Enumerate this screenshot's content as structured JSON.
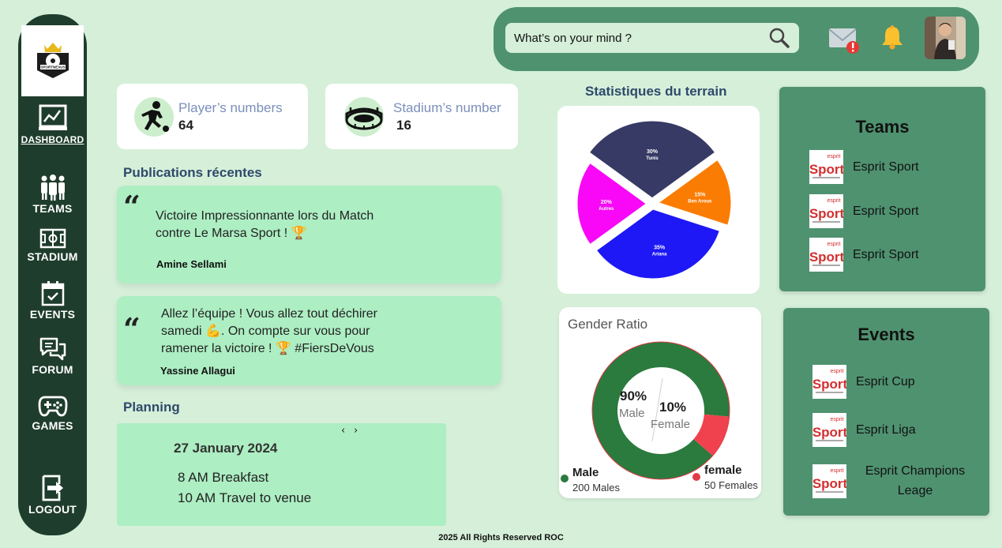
{
  "brand": {
    "logo_text": "SPORTNEXUS"
  },
  "sidebar": {
    "items": [
      {
        "label": "DASHBOARD",
        "icon": "chart-icon"
      },
      {
        "label": "TEAMS",
        "icon": "team-icon"
      },
      {
        "label": "STADIUM",
        "icon": "field-icon"
      },
      {
        "label": "EVENTS",
        "icon": "calendar-icon"
      },
      {
        "label": "FORUM",
        "icon": "chat-icon"
      },
      {
        "label": "GAMES",
        "icon": "gamepad-icon"
      }
    ],
    "logout_label": "LOGOUT"
  },
  "header": {
    "search_placeholder": "What’s on your mind ?",
    "icons": [
      "search-icon",
      "mail-alert-icon",
      "bell-icon",
      "avatar"
    ]
  },
  "stats": [
    {
      "label": "Player’s numbers",
      "value": "64",
      "icon": "player-kick-icon"
    },
    {
      "label": "Stadium’s number",
      "value": "16",
      "icon": "stadium-icon"
    }
  ],
  "publications": {
    "title": "Publications récentes",
    "posts": [
      {
        "text_lines": [
          "Victoire Impressionnante lors du Match",
          "contre Le Marsa Sport ! 🏆"
        ],
        "author": "Amine Sellami"
      },
      {
        "text_lines": [
          "Allez l’équipe ! Vous allez tout déchirer",
          "samedi 💪. On compte sur vous pour",
          "ramener la victoire ! 🏆 #FiersDeVous"
        ],
        "author": "Yassine Allagui"
      }
    ]
  },
  "planning": {
    "title": "Planning",
    "nav_prev": "‹",
    "nav_next": "›",
    "date": "27 January 2024",
    "entries": [
      "8 AM Breakfast",
      "10 AM Travel to venue"
    ]
  },
  "terrain_stats": {
    "title": "Statistiques du terrain"
  },
  "gender": {
    "title": "Gender Ratio",
    "male_pct": "90%",
    "male_word": "Male",
    "female_pct": "10%",
    "female_word": "Female",
    "legend": [
      {
        "label": "Male",
        "sub": "200 Males",
        "color": "#2b7a3e"
      },
      {
        "label": "female",
        "sub": "50 Females",
        "color": "#e03b46"
      }
    ]
  },
  "chart_data": [
    {
      "type": "pie",
      "title": "Statistiques du terrain",
      "slices": [
        {
          "label": "Tunis",
          "value": 30,
          "text": "30%",
          "color": "#363a64"
        },
        {
          "label": "Ben Arous",
          "value": 15,
          "text": "15%",
          "color": "#fb7c02"
        },
        {
          "label": "Ariana",
          "value": 35,
          "text": "35%",
          "color": "#1d18f5"
        },
        {
          "label": "Autres",
          "value": 20,
          "text": "20%",
          "color": "#f808f6"
        }
      ]
    },
    {
      "type": "pie",
      "title": "Gender Ratio",
      "slices": [
        {
          "label": "Male",
          "value": 90,
          "text": "90%",
          "color": "#2b7a3e"
        },
        {
          "label": "Female",
          "value": 10,
          "text": "10%",
          "color": "#f0424e"
        }
      ]
    }
  ],
  "teams": {
    "title": "Teams",
    "items": [
      "Esprit Sport",
      "Esprit Sport",
      "Esprit Sport"
    ]
  },
  "events": {
    "title": "Events",
    "items": [
      "Esprit Cup",
      "Esprit Liga",
      "Esprit Champions Leage"
    ]
  },
  "thumb_text": {
    "top": "esprit",
    "main": "Sport"
  },
  "footer": "2025 All Rights Reserved ROC"
}
